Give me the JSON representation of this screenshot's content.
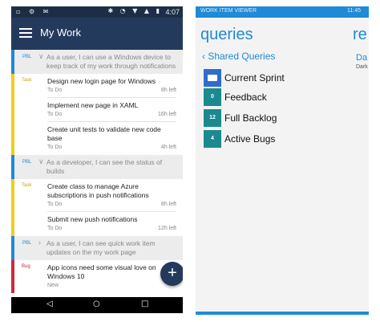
{
  "android": {
    "status_bar": {
      "left_icons": "▫ ⚙ ✉",
      "right_icons": "✱ ◔ ▼ ▲ ▮",
      "time": "4:07"
    },
    "app_bar": {
      "title": "My Work"
    },
    "groups": [
      {
        "header": {
          "tag": "PBL",
          "text": "As a user, I can use a Windows device to keep track of my work through notifications"
        },
        "items": [
          {
            "tag": "Task",
            "name": "Design new login page for Windows",
            "state": "To Do",
            "duration": "8h left"
          },
          {
            "tag": "",
            "name": "Implement new page in XAML",
            "state": "To Do",
            "duration": "16h left"
          },
          {
            "tag": "",
            "name": "Create unit tests to validate new code base",
            "state": "To Do",
            "duration": "4h left"
          }
        ]
      },
      {
        "header": {
          "tag": "PBL",
          "text": "As a developer, I can see the status of builds"
        },
        "items": [
          {
            "tag": "Task",
            "name": "Create class to manage Azure subscriptions in push notifications",
            "state": "To Do",
            "duration": "8h left"
          },
          {
            "tag": "",
            "name": "Submit new push notifications",
            "state": "To Do",
            "duration": "12h left"
          }
        ]
      },
      {
        "header": {
          "tag": "PBL",
          "text": "As a user, I can see quick work item updates on the my work page"
        },
        "items": [
          {
            "tag": "Bug",
            "name": "App icons need some visual love on Windows 10",
            "state": "New",
            "duration": ""
          }
        ]
      }
    ],
    "fab_label": "+",
    "nav_bar": {
      "back": "◁",
      "home": "○",
      "recents": "□"
    }
  },
  "windows_phone": {
    "top_bar": {
      "app_name": "WORK ITEM VIEWER",
      "count": "11:45"
    },
    "title": "queries",
    "next_title": "re",
    "back_link": "‹ Shared Queries",
    "next_sub1": "Da",
    "next_sub2": "Dark",
    "queries": [
      {
        "label": "Current Sprint",
        "count": "",
        "icon": "folder-icon",
        "color": "#2f6cce"
      },
      {
        "label": "Feedback",
        "count": "0",
        "icon": "",
        "color": "#1a8a8f"
      },
      {
        "label": "Full Backlog",
        "count": "12",
        "icon": "",
        "color": "#1a8a8f"
      },
      {
        "label": "Active Bugs",
        "count": "4",
        "icon": "",
        "color": "#1a8a8f"
      }
    ]
  }
}
